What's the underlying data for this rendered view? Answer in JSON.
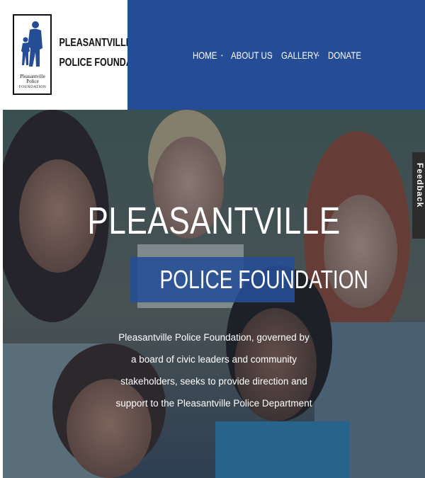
{
  "logo": {
    "name_line1": "PLEASANTVILLE",
    "name_line2": "POLICE FOUNDATION",
    "seal_line1": "Pleasantville Police",
    "seal_line2": "FOUNDATION",
    "icon": "officer-with-child-icon"
  },
  "nav": {
    "items": [
      "HOME",
      "ABOUT US",
      "GALLERY",
      "DONATE"
    ],
    "separator": "•"
  },
  "hero": {
    "title": "PLEASANTVILLE",
    "subtitle": "POLICE FOUNDATION",
    "description": "Pleasantville Police Foundation, governed by a board of civic leaders and community stakeholders, seeks to provide direction and support to the Pleasantville Police Department"
  },
  "feedback": {
    "label": "Feedback"
  },
  "colors": {
    "brand_blue": "#254d96",
    "feedback_bg": "#2c2c2c",
    "hero_overlay": "#1f2f45"
  }
}
